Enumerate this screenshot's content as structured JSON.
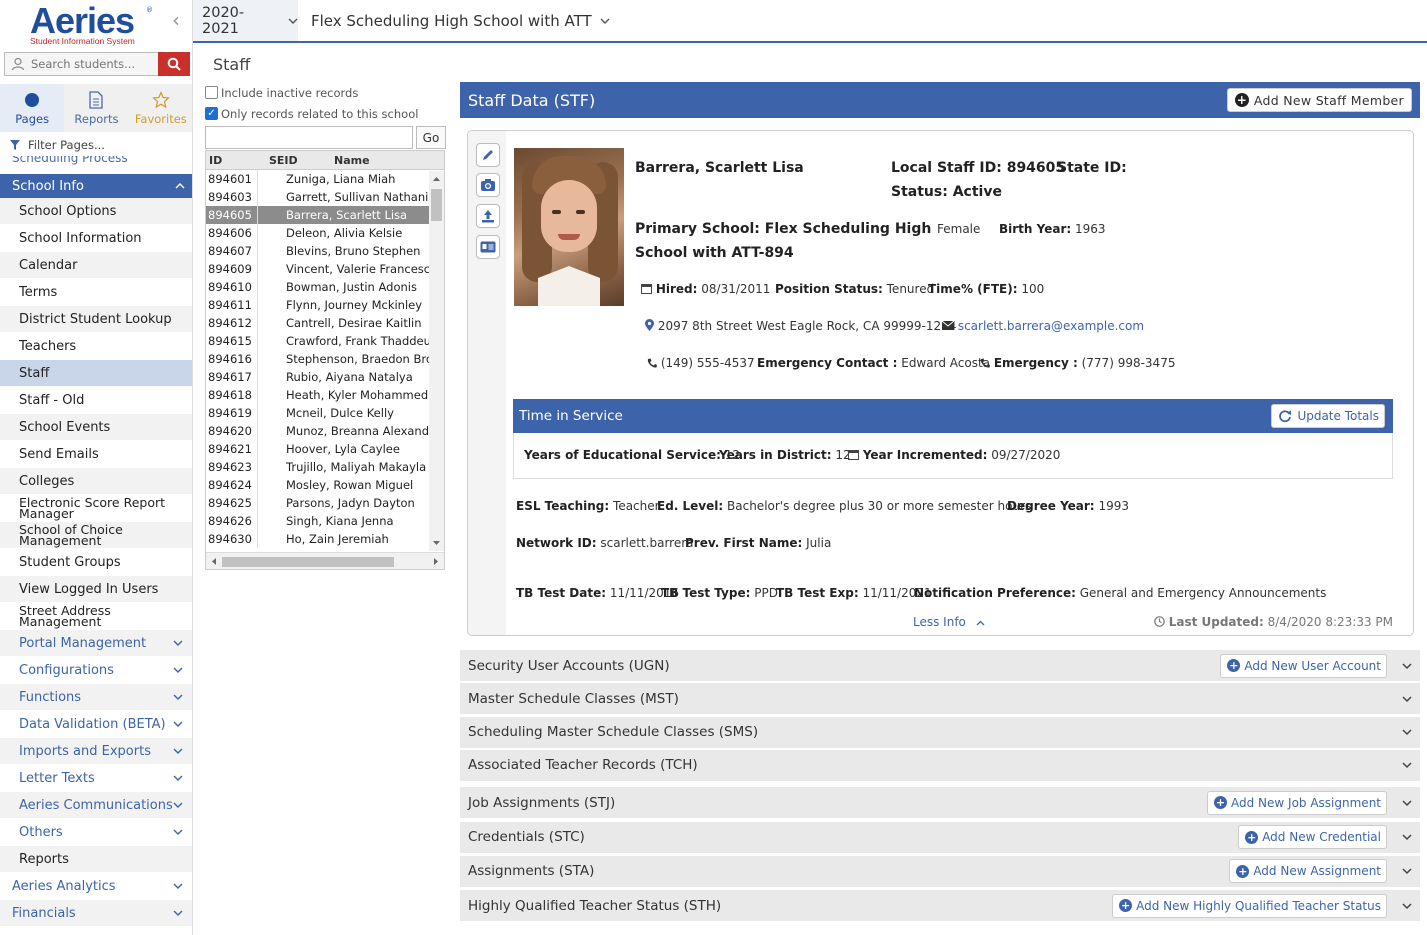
{
  "brand": {
    "name": "Aeries",
    "reg": "®",
    "subtitle": "Student Information System"
  },
  "search": {
    "placeholder": "Search students..."
  },
  "nav_tabs": [
    {
      "label": "Pages"
    },
    {
      "label": "Reports"
    },
    {
      "label": "Favorites"
    }
  ],
  "filter": {
    "label": "Filter Pages..."
  },
  "menu": {
    "cut_item": "Scheduling Process",
    "section": "School Info",
    "items": [
      "School Options",
      "School Information",
      "Calendar",
      "Terms",
      "District Student Lookup",
      "Teachers",
      "Staff",
      "Staff - Old",
      "School Events",
      "Send Emails",
      "Colleges",
      "Electronic Score Report Manager",
      "School of Choice Management",
      "Student Groups",
      "View Logged In Users",
      "Street Address Management"
    ],
    "sub_items": [
      "Portal Management",
      "Configurations",
      "Functions",
      "Data Validation (BETA)",
      "Imports and Exports",
      "Letter Texts",
      "Aeries Communications",
      "Others"
    ],
    "reports": "Reports",
    "top_items": [
      "Aeries Analytics",
      "Financials"
    ]
  },
  "topbar": {
    "year": "2020-2021",
    "school": "Flex Scheduling High School with ATT"
  },
  "page_title": "Staff",
  "list": {
    "include_inactive": "Include inactive records",
    "only_related": "Only records related to this school",
    "go": "Go",
    "headers": [
      "ID",
      "SEID",
      "Name"
    ],
    "rows": [
      {
        "id": "894601",
        "name": "Zuniga, Liana Miah"
      },
      {
        "id": "894603",
        "name": "Garrett, Sullivan Nathaniel"
      },
      {
        "id": "894605",
        "name": "Barrera, Scarlett Lisa"
      },
      {
        "id": "894606",
        "name": "Deleon, Alivia Kelsie"
      },
      {
        "id": "894607",
        "name": "Blevins, Bruno Stephen"
      },
      {
        "id": "894609",
        "name": "Vincent, Valerie Francesca"
      },
      {
        "id": "894610",
        "name": "Bowman, Justin Adonis"
      },
      {
        "id": "894611",
        "name": "Flynn, Journey Mckinley"
      },
      {
        "id": "894612",
        "name": "Cantrell, Desirae Kaitlin"
      },
      {
        "id": "894615",
        "name": "Crawford, Frank Thaddeus"
      },
      {
        "id": "894616",
        "name": "Stephenson, Braedon Brody"
      },
      {
        "id": "894617",
        "name": "Rubio, Aiyana Natalya"
      },
      {
        "id": "894618",
        "name": "Heath, Kyler Mohammed"
      },
      {
        "id": "894619",
        "name": "Mcneil, Dulce Kelly"
      },
      {
        "id": "894620",
        "name": "Munoz, Breanna Alexandra"
      },
      {
        "id": "894621",
        "name": "Hoover, Lyla Caylee"
      },
      {
        "id": "894623",
        "name": "Trujillo, Maliyah Makayla"
      },
      {
        "id": "894624",
        "name": "Mosley, Rowan Miguel"
      },
      {
        "id": "894625",
        "name": "Parsons, Jadyn Dayton"
      },
      {
        "id": "894626",
        "name": "Singh, Kiana Jenna"
      },
      {
        "id": "894630",
        "name": "Ho, Zain Jeremiah"
      }
    ]
  },
  "staff": {
    "header": "Staff Data (STF)",
    "add_button": "Add New Staff Member",
    "name": "Barrera, Scarlett Lisa",
    "local_id": "Local Staff ID: 894605",
    "state_id": "State ID:",
    "status": "Status: Active",
    "primary_school_1": "Primary School: Flex Scheduling High",
    "primary_school_2": "School with ATT-894",
    "gender": "Female",
    "birth_year_label": "Birth Year:",
    "birth_year": "1963",
    "hired_label": "Hired:",
    "hired": "08/31/2011",
    "position_status_label": "Position Status:",
    "position_status": "Tenured",
    "fte_label": "Time% (FTE):",
    "fte": "100",
    "address": "2097 8th Street West Eagle Rock, CA 99999-1234",
    "email": "scarlett.barrera@example.com",
    "phone": "(149) 555-4537",
    "emergency_contact_label": "Emergency Contact :",
    "emergency_contact": "Edward Acosta",
    "emergency_label": "Emergency :",
    "emergency": "(777) 998-3475",
    "tis_header": "Time in Service",
    "update_totals": "Update Totals",
    "yrs_edu_label": "Years of Educational Service:",
    "yrs_edu": "12",
    "yrs_district_label": "Years in District:",
    "yrs_district": "12",
    "year_inc_label": "Year Incremented:",
    "year_inc": "09/27/2020",
    "esl_label": "ESL Teaching:",
    "esl": "Teacher",
    "ed_level_label": "Ed. Level:",
    "ed_level": "Bachelor's degree plus 30 or more semester hours",
    "degree_year_label": "Degree Year:",
    "degree_year": "1993",
    "network_label": "Network ID:",
    "network": "scarlett.barrera",
    "prev_first_label": "Prev. First Name:",
    "prev_first": "Julia",
    "tb_date_label": "TB Test Date:",
    "tb_date": "11/11/2016",
    "tb_type_label": "TB Test Type:",
    "tb_type": "PPD",
    "tb_exp_label": "TB Test Exp:",
    "tb_exp": "11/11/2021",
    "notif_label": "Notification Preference:",
    "notif": "General and Emergency Announcements",
    "less_info": "Less Info",
    "last_updated_label": "Last Updated:",
    "last_updated": "8/4/2020 8:23:33 PM"
  },
  "sections": [
    {
      "title": "Security User Accounts (UGN)",
      "button": "Add New User Account"
    },
    {
      "title": "Master Schedule Classes (MST)",
      "button": ""
    },
    {
      "title": "Scheduling Master Schedule Classes (SMS)",
      "button": ""
    },
    {
      "title": "Associated Teacher Records (TCH)",
      "button": ""
    },
    {
      "title": "Job Assignments (STJ)",
      "button": "Add New Job Assignment"
    },
    {
      "title": "Credentials (STC)",
      "button": "Add New Credential"
    },
    {
      "title": "Assignments (STA)",
      "button": "Add New Assignment"
    },
    {
      "title": "Highly Qualified Teacher Status (STH)",
      "button": "Add New Highly Qualified Teacher Status"
    }
  ],
  "colors": {
    "primary": "#3d64aa",
    "brand": "#1f4e9c",
    "accent_red": "#c9302c"
  }
}
